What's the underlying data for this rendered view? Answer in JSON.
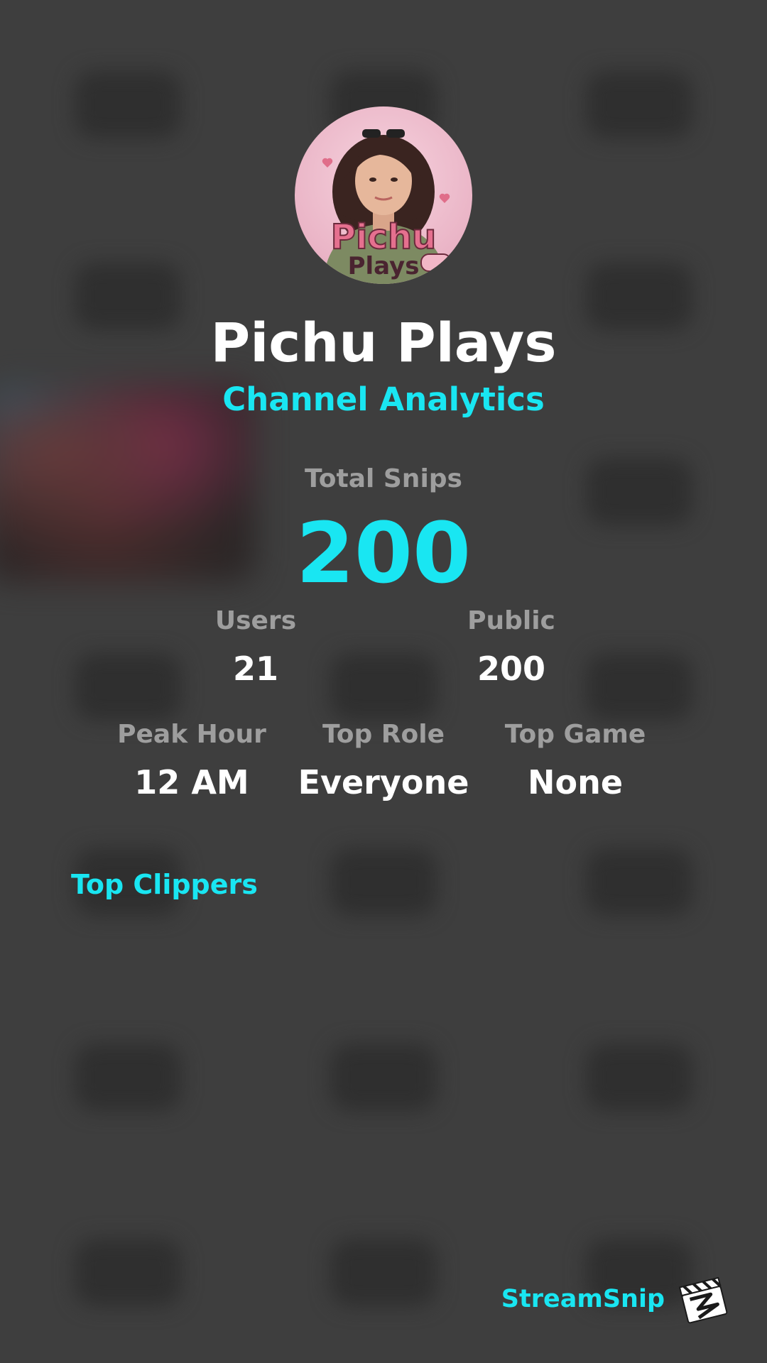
{
  "channel": {
    "name": "Pichu Plays",
    "subtitle": "Channel Analytics",
    "avatar_icon": "pichu-plays-avatar"
  },
  "totals": {
    "label": "Total Snips",
    "value": "200"
  },
  "stats_row1": {
    "users": {
      "label": "Users",
      "value": "21"
    },
    "public": {
      "label": "Public",
      "value": "200"
    }
  },
  "stats_row2": {
    "peak_hour": {
      "label": "Peak Hour",
      "value": "12 AM"
    },
    "top_role": {
      "label": "Top Role",
      "value": "Everyone"
    },
    "top_game": {
      "label": "Top Game",
      "value": "None"
    }
  },
  "sections": {
    "top_clippers_title": "Top Clippers"
  },
  "footer": {
    "brand": "StreamSnip",
    "logo_icon": "clapperboard-icon"
  },
  "colors": {
    "background": "#3e3e3e",
    "accent": "#19e6f2",
    "label": "#9e9e9e",
    "value": "#ffffff"
  }
}
